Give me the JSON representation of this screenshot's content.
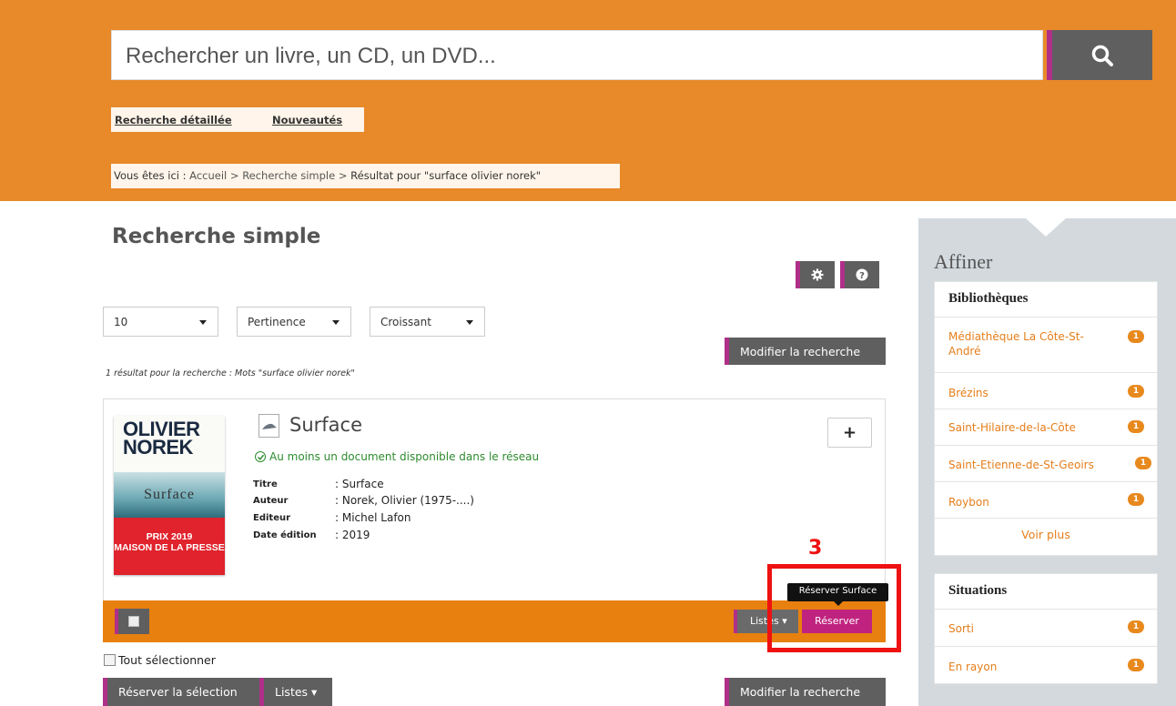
{
  "search": {
    "placeholder": "Rechercher un livre, un CD, un DVD...",
    "button_icon": "search-icon"
  },
  "header_links": {
    "advanced": "Recherche détaillée",
    "new_items": "Nouveautés"
  },
  "breadcrumb": {
    "prefix": "Vous êtes ici :",
    "home": "Accueil",
    "simple": "Recherche simple",
    "current": "Résultat pour \"surface olivier norek\"",
    "separator": ">"
  },
  "page": {
    "title": "Recherche simple",
    "settings_icon": "gear-icon",
    "help_icon": "help-icon"
  },
  "sort": {
    "per_page": "10",
    "sort_by": "Pertinence",
    "order": "Croissant"
  },
  "actions": {
    "modify_search": "Modifier la recherche",
    "reserve_selection": "Réserver la sélection",
    "lists": "Listes",
    "select_all": "Tout sélectionner"
  },
  "results": {
    "count_text": "1 résultat pour la recherche : Mots \"surface olivier norek\"",
    "items": [
      {
        "title": "Surface",
        "availability": "Au moins un document disponible dans le réseau",
        "cover": {
          "author_line1": "OLIVIER",
          "author_line2": "NOREK",
          "book_title": "Surface",
          "prize_line1": "PRIX 2019",
          "prize_line2": "MAISON DE LA PRESSE"
        },
        "metadata": [
          {
            "label": "Titre",
            "value": ": Surface"
          },
          {
            "label": "Auteur",
            "value": ": Norek, Olivier (1975-....)"
          },
          {
            "label": "Editeur",
            "value": ": Michel Lafon"
          },
          {
            "label": "Date édition",
            "value": ": 2019"
          }
        ],
        "plus_label": "+",
        "lists_label": "Listes",
        "reserve_label": "Réserver",
        "reserve_tooltip": "Réserver Surface"
      }
    ]
  },
  "annotation": {
    "number": "3",
    "color": "#e11111"
  },
  "sidebar": {
    "title": "Affiner",
    "libraries": {
      "heading": "Bibliothèques",
      "items": [
        {
          "label": "Médiathèque La Côte-St-André",
          "count": "1"
        },
        {
          "label": "Brézins",
          "count": "1"
        },
        {
          "label": "Saint-Hilaire-de-la-Côte",
          "count": "1"
        },
        {
          "label": "Saint-Etienne-de-St-Geoirs",
          "count": "1"
        },
        {
          "label": "Roybon",
          "count": "1"
        }
      ],
      "more": "Voir plus"
    },
    "situations": {
      "heading": "Situations",
      "items": [
        {
          "label": "Sorti",
          "count": "1"
        },
        {
          "label": "En rayon",
          "count": "1"
        }
      ]
    }
  },
  "colors": {
    "header_orange": "#e8892a",
    "accent_magenta": "#b03089",
    "reserve_pink": "#c0237f",
    "button_gray": "#5f5f5f",
    "facet_orange": "#e57e1b",
    "available_green": "#2e8b2e"
  }
}
